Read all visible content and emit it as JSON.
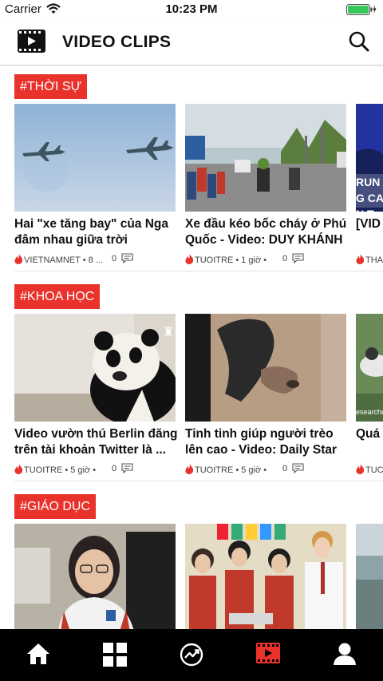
{
  "status_bar": {
    "carrier": "Carrier",
    "time": "10:23 PM"
  },
  "header": {
    "title": "VIDEO CLIPS",
    "icons": [
      "film-icon",
      "search-icon"
    ]
  },
  "sections": [
    {
      "tag": "#THỜI SỰ",
      "cards": [
        {
          "title": "Hai \"xe tăng bay\" của Nga đâm nhau giữa trời",
          "source": "VIETNAMNET • 8 ...",
          "comments": "0"
        },
        {
          "title": "Xe đầu kéo bốc cháy ở Phú Quốc - Video: DUY KHÁNH",
          "source": "TUOITRE • 1 giờ •",
          "comments": "0"
        },
        {
          "title": "[VID leo th",
          "source": "THA",
          "comments": "",
          "thumb_text": "RUNG CAN T"
        }
      ]
    },
    {
      "tag": "#KHOA HỌC",
      "cards": [
        {
          "title": "Video vườn thú Berlin đăng trên tài khoản Twitter là ...",
          "source": "TUOITRE • 5 giờ •",
          "comments": "0"
        },
        {
          "title": "Tinh tinh giúp người trèo lên cao - Video: Daily Star",
          "source": "TUOITRE • 5 giờ •",
          "comments": "0"
        },
        {
          "title": "Quá nghi",
          "source": "TUC",
          "comments": "",
          "thumb_text": "esearcher"
        }
      ]
    },
    {
      "tag": "#GIÁO DỤC",
      "cards": [
        {
          "title": "",
          "source": "",
          "comments": ""
        },
        {
          "title": "",
          "source": "",
          "comments": ""
        },
        {
          "title": "",
          "source": "",
          "comments": ""
        }
      ]
    }
  ],
  "tab_bar": {
    "tabs": [
      "home-icon",
      "grid-icon",
      "trending-icon",
      "video-icon",
      "profile-icon"
    ],
    "active_index": 3
  },
  "colors": {
    "accent": "#e8322b",
    "tab_bar": "#000000",
    "active_tab": "#e8322b"
  }
}
